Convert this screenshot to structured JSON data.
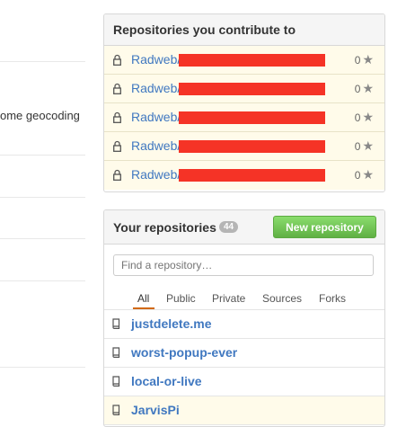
{
  "feed": {
    "text_fragment": "ome geocoding"
  },
  "contribute": {
    "title": "Repositories you contribute to",
    "rows": [
      {
        "owner": "Radweb/",
        "stars": "0"
      },
      {
        "owner": "Radweb/",
        "stars": "0"
      },
      {
        "owner": "Radweb/",
        "stars": "0"
      },
      {
        "owner": "Radweb/",
        "stars": "0"
      },
      {
        "owner": "Radweb/",
        "stars": "0"
      }
    ]
  },
  "your_repos": {
    "title": "Your repositories",
    "count": "44",
    "new_button": "New repository",
    "search_placeholder": "Find a repository…",
    "tabs": [
      "All",
      "Public",
      "Private",
      "Sources",
      "Forks"
    ],
    "selected_tab": "All",
    "repos": [
      {
        "name": "justdelete.me"
      },
      {
        "name": "worst-popup-ever"
      },
      {
        "name": "local-or-live"
      },
      {
        "name": "JarvisPi"
      }
    ]
  },
  "colors": {
    "link": "#4078c0",
    "accent_green": "#60b044",
    "tab_underline": "#d26911",
    "redaction": "#f53326",
    "highlight_row": "#fffbea"
  },
  "icons": [
    "lock-icon",
    "star-icon",
    "repo-book-icon"
  ]
}
